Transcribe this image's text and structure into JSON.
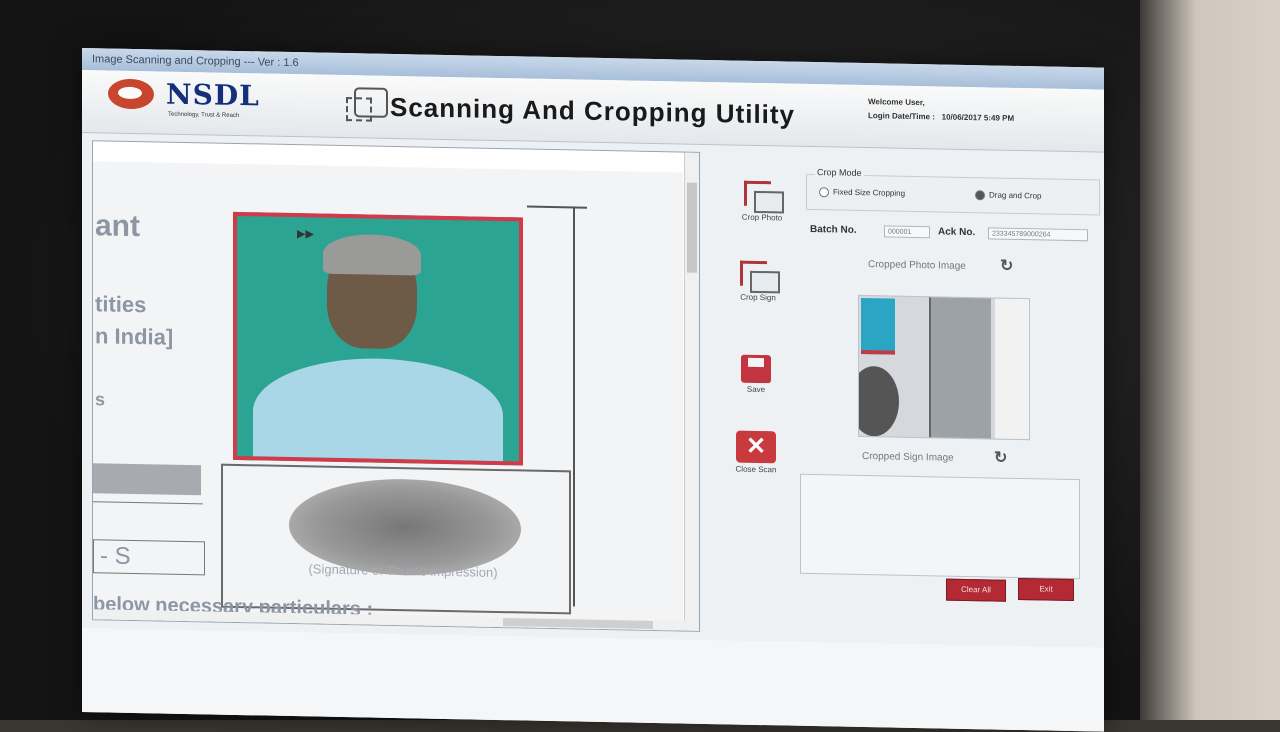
{
  "window": {
    "title": "Image Scanning and Cropping --- Ver : 1.6"
  },
  "header": {
    "brand": "NSDL",
    "brand_tagline": "Technology, Trust & Reach",
    "app_title": "Scanning And Cropping Utility",
    "welcome_label": "Welcome User,",
    "login_label": "Login Date/Time :",
    "login_value": "10/06/2017 5:49 PM"
  },
  "document": {
    "text_ant": "ant",
    "text_tities": "tities",
    "text_india": "n India]",
    "text_s": "s",
    "text_grid": "- S",
    "thumb_caption": "(Signature of Thumb impression)",
    "footer_text": "below necessary particulars :"
  },
  "toolbar": {
    "crop_photo": "Crop Photo",
    "crop_sign": "Crop Sign",
    "save": "Save",
    "close_scan": "Close Scan"
  },
  "crop_mode": {
    "legend": "Crop Mode",
    "option_fixed": "Fixed Size Cropping",
    "option_drag": "Drag and Crop",
    "selected": "Drag and Crop"
  },
  "fields": {
    "batch_label": "Batch No.",
    "batch_value": "000001",
    "ack_label": "Ack No.",
    "ack_value": "233345789000264"
  },
  "panels": {
    "photo_title": "Cropped Photo Image",
    "sign_title": "Cropped Sign Image"
  },
  "buttons": {
    "clear_all": "Clear All",
    "exit": "Exit"
  },
  "icons": {
    "refresh_photo": "refresh-icon",
    "refresh_sign": "refresh-icon"
  }
}
